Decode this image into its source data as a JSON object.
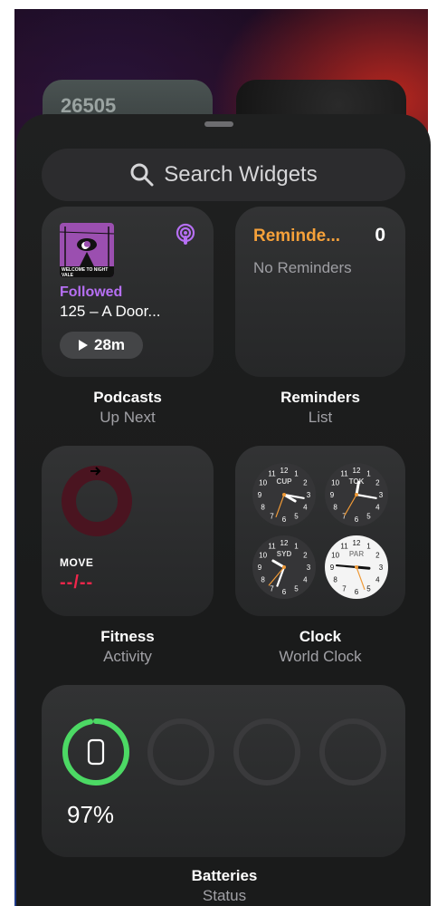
{
  "peek": {
    "left_value": "26505"
  },
  "search": {
    "placeholder": "Search Widgets"
  },
  "podcasts": {
    "art_caption": "WELCOME TO NIGHT VALE",
    "status": "Followed",
    "episode": "125 – A Door...",
    "duration": "28m",
    "title": "Podcasts",
    "subtitle": "Up Next"
  },
  "reminders": {
    "list_name": "Reminde...",
    "count": "0",
    "empty": "No Reminders",
    "title": "Reminders",
    "subtitle": "List"
  },
  "fitness": {
    "ring_label": "MOVE",
    "value": "--/--",
    "title": "Fitness",
    "subtitle": "Activity",
    "move_color": "#f0264b"
  },
  "clock": {
    "title": "Clock",
    "subtitle": "World Clock",
    "cities": [
      "CUP",
      "TOK",
      "SYD",
      "PAR"
    ]
  },
  "batteries": {
    "percent": "97%",
    "level": 0.97,
    "title": "Batteries",
    "subtitle": "Status",
    "ring_color": "#4cd964"
  },
  "colors": {
    "accent_purple": "#b66ff3",
    "accent_orange": "#f6a13a"
  }
}
